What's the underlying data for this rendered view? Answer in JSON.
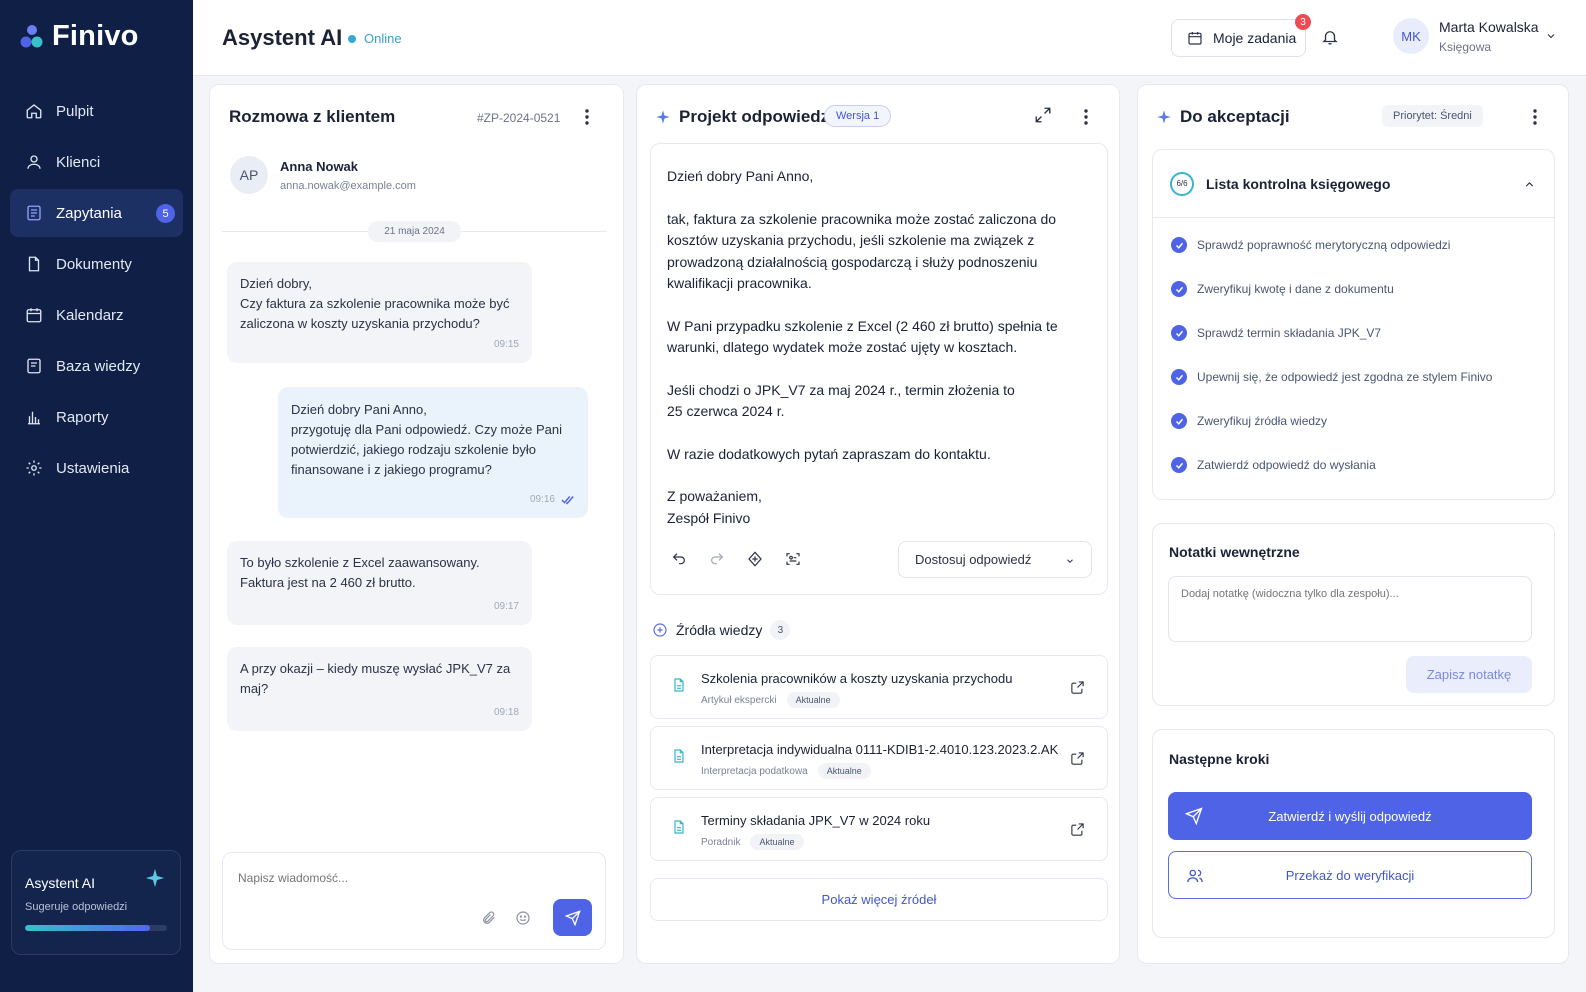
{
  "app": {
    "name": "Finivo"
  },
  "sidebar": {
    "items": [
      {
        "label": "Pulpit",
        "icon": "home-icon"
      },
      {
        "label": "Klienci",
        "icon": "user-icon"
      },
      {
        "label": "Zapytania",
        "icon": "inbox-icon",
        "badge": "5",
        "active": true
      },
      {
        "label": "Dokumenty",
        "icon": "document-icon"
      },
      {
        "label": "Kalendarz",
        "icon": "calendar-icon"
      },
      {
        "label": "Baza wiedzy",
        "icon": "book-icon"
      },
      {
        "label": "Raporty",
        "icon": "bar-chart-icon"
      },
      {
        "label": "Ustawienia",
        "icon": "gear-icon"
      }
    ],
    "ai_card": {
      "title": "Asystent AI",
      "subtitle": "Sugeruje odpowiedzi",
      "progress": 0.88
    }
  },
  "header": {
    "title": "Asystent AI",
    "status": "Online",
    "tasks_label": "Moje zadania",
    "tasks_badge": "3",
    "user": {
      "initials": "MK",
      "name": "Marta Kowalska",
      "role": "Księgowa"
    }
  },
  "conversation": {
    "title": "Rozmowa z klientem",
    "ticket_id": "#ZP-2024-0521",
    "client": {
      "initials": "AP",
      "name": "Anna Nowak",
      "email": "anna.nowak@example.com"
    },
    "date": "21 maja 2024",
    "messages": [
      {
        "direction": "in",
        "text": "Dzień dobry,\nCzy faktura za szkolenie pracownika może być zaliczona w koszty uzyskania przychodu?",
        "time": "09:15"
      },
      {
        "direction": "out",
        "text": "Dzień dobry Pani Anno,\nprzygotuję dla Pani odpowiedź. Czy może Pani potwierdzić, jakiego rodzaju szkolenie było finansowane i z jakiego programu?",
        "time": "09:16"
      },
      {
        "direction": "in",
        "text": "To było szkolenie z Excel zaawansowany.\nFaktura jest na 2 460 zł brutto.",
        "time": "09:17"
      },
      {
        "direction": "in",
        "text": "A przy okazji – kiedy muszę wysłać JPK_V7 za maj?",
        "time": "09:18"
      }
    ],
    "composer_placeholder": "Napisz wiadomość..."
  },
  "draft": {
    "title": "Projekt odpowiedzi",
    "version": "Wersja 1",
    "paragraphs": [
      "Dzień dobry Pani Anno,",
      "tak, faktura za szkolenie pracownika może zostać zaliczona do kosztów uzyskania przychodu, jeśli szkolenie ma związek z prowadzoną działalnością gospodarczą i służy podnoszeniu kwalifikacji pracownika.",
      "W Pani przypadku szkolenie z Excel (2 460 zł brutto) spełnia te warunki, dlatego wydatek może zostać ujęty w kosztach.",
      "Jeśli chodzi o JPK_V7 za maj 2024 r., termin złożenia to\n25 czerwca 2024 r.",
      "W razie dodatkowych pytań zapraszam do kontaktu.",
      "Z poważaniem,\nZespół Finivo"
    ],
    "adjust_label": "Dostosuj odpowiedź",
    "sources_title": "Źródła wiedzy",
    "sources_count": "3",
    "sources": [
      {
        "title": "Szkolenia pracowników a koszty uzyskania przychodu",
        "type": "Artykuł ekspercki",
        "tag": "Aktualne"
      },
      {
        "title": "Interpretacja indywidualna 0111-KDIB1-2.4010.123.2023.2.AK",
        "type": "Interpretacja podatkowa",
        "tag": "Aktualne"
      },
      {
        "title": "Terminy składania JPK_V7 w 2024 roku",
        "type": "Poradnik",
        "tag": "Aktualne"
      }
    ],
    "more_sources": "Pokaż więcej źródeł"
  },
  "approval": {
    "title": "Do akceptacji",
    "priority": "Priorytet: Średni",
    "checklist_title": "Lista kontrolna księgowego",
    "checklist_progress": "6/6",
    "checklist": [
      "Sprawdź poprawność merytoryczną odpowiedzi",
      "Zweryfikuj kwotę i dane z dokumentu",
      "Sprawdź termin składania JPK_V7",
      "Upewnij się, że odpowiedź jest zgodna ze stylem Finivo",
      "Zweryfikuj źródła wiedzy",
      "Zatwierdź odpowiedź do wysłania"
    ],
    "notes_title": "Notatki wewnętrzne",
    "notes_placeholder": "Dodaj notatkę (widoczna tylko dla zespołu)...",
    "save_note": "Zapisz notatkę",
    "next_title": "Następne kroki",
    "approve_send": "Zatwierdź i wyślij odpowiedź",
    "forward": "Przekaż do weryfikacji"
  },
  "colors": {
    "accent": "#4e63e6",
    "sidebar_bg": "#0f1f45",
    "online": "#38a9d6"
  }
}
